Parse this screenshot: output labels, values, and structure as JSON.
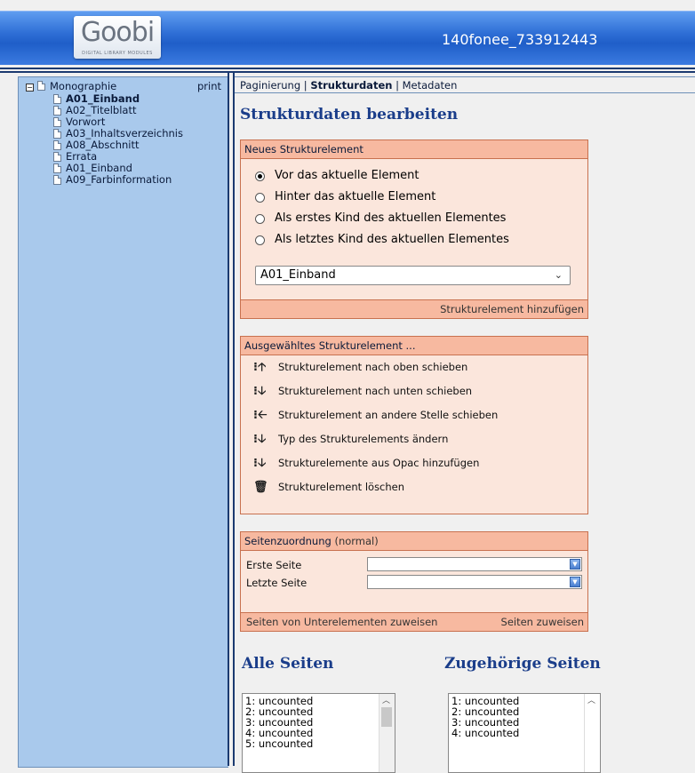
{
  "header": {
    "logo_text": "Goobi",
    "logo_sub": "DIGITAL LIBRARY MODULES",
    "process_title": "140fonee_733912443"
  },
  "sidebar": {
    "root_label": "Monographie",
    "print_label": "print",
    "items": [
      {
        "label": "A01_Einband",
        "selected": true
      },
      {
        "label": "A02_Titelblatt",
        "selected": false
      },
      {
        "label": "Vorwort",
        "selected": false
      },
      {
        "label": "A03_Inhaltsverzeichnis",
        "selected": false
      },
      {
        "label": "A08_Abschnitt",
        "selected": false
      },
      {
        "label": "Errata",
        "selected": false
      },
      {
        "label": "A01_Einband",
        "selected": false
      },
      {
        "label": "A09_Farbinformation",
        "selected": false
      }
    ]
  },
  "tabs": {
    "pagination": "Paginierung",
    "structure": "Strukturdaten",
    "metadata": "Metadaten",
    "separator": "|"
  },
  "page_title": "Strukturdaten bearbeiten",
  "new_element": {
    "header": "Neues Strukturelement",
    "options": [
      {
        "label": "Vor das aktuelle Element",
        "checked": true
      },
      {
        "label": "Hinter das aktuelle Element",
        "checked": false
      },
      {
        "label": "Als erstes Kind des aktuellen Elementes",
        "checked": false
      },
      {
        "label": "Als letztes Kind des aktuellen Elementes",
        "checked": false
      }
    ],
    "select_value": "A01_Einband",
    "footer_action": "Strukturelement hinzufügen"
  },
  "selected_element": {
    "header": "Ausgewähltes Strukturelement ...",
    "actions": [
      {
        "icon": "arrow-up-icon",
        "glyph": "⁝🡡",
        "label": "Strukturelement nach oben schieben"
      },
      {
        "icon": "arrow-down-icon",
        "glyph": "⁝🡣",
        "label": "Strukturelement nach unten schieben"
      },
      {
        "icon": "arrow-left-icon",
        "glyph": "⁝🡠",
        "label": "Strukturelement an andere Stelle schieben"
      },
      {
        "icon": "arrow-down-icon",
        "glyph": "⁝🡣",
        "label": "Typ des Strukturelements ändern"
      },
      {
        "icon": "arrow-down-icon",
        "glyph": "⁝🡣",
        "label": "Strukturelemente aus Opac hinzufügen"
      },
      {
        "icon": "trash-icon",
        "glyph": "🗑",
        "label": "Strukturelement löschen"
      }
    ]
  },
  "page_assignment": {
    "header": "Seitenzuordnung",
    "header_mode": "(normal)",
    "first_page_label": "Erste Seite",
    "last_page_label": "Letzte Seite",
    "first_page_value": "",
    "last_page_value": "",
    "sub_elements_action": "Seiten von Unterelementen zuweisen",
    "assign_action": "Seiten zuweisen"
  },
  "all_pages": {
    "title": "Alle Seiten",
    "items": [
      "1: uncounted",
      "2: uncounted",
      "3: uncounted",
      "4: uncounted",
      "5: uncounted"
    ]
  },
  "related_pages": {
    "title": "Zugehörige Seiten",
    "items": [
      "1: uncounted",
      "2: uncounted",
      "3: uncounted",
      "4: uncounted"
    ]
  },
  "colors": {
    "header_blue": "#2f6fd6",
    "sidebar_bg": "#a9c9ec",
    "box_bg": "#fbe6dc",
    "box_head": "#f7b9a0",
    "title_blue": "#1a3d8a"
  }
}
